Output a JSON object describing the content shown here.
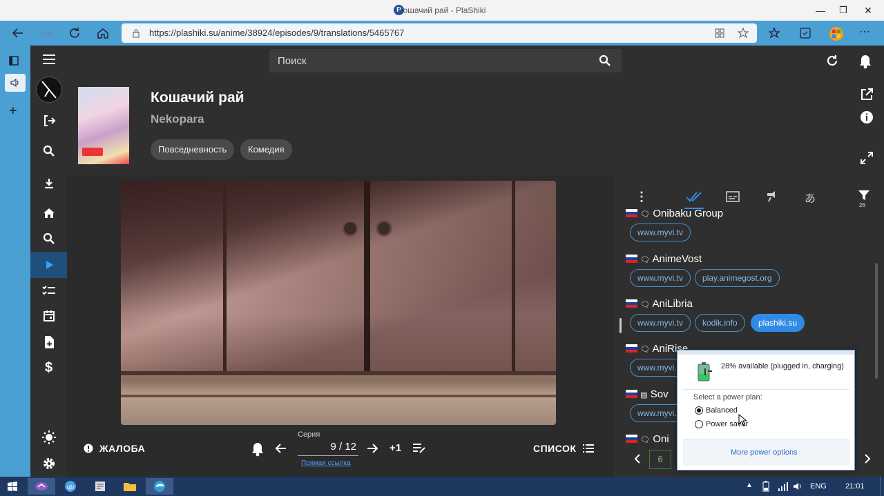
{
  "window": {
    "title": "Кошачий рай - PlaShiki",
    "minimize": "—",
    "maximize": "❐",
    "close": "✕"
  },
  "browser": {
    "url": "https://plashiki.su/anime/38924/episodes/9/translations/5465767"
  },
  "header": {
    "search_placeholder": "Поиск"
  },
  "anime": {
    "title": "Кошачий рай",
    "original_title": "Nekopara",
    "genres": [
      "Повседневность",
      "Комедия"
    ]
  },
  "player": {
    "report_label": "ЖАЛОБА",
    "episode_caption": "Серия",
    "episode_value": "9 / 12",
    "plus_one": "+1",
    "direct_link": "Прямая ссылка",
    "list_label": "СПИСОК"
  },
  "translations": {
    "filter_count": "26",
    "groups": [
      {
        "name": "Onibaku Group",
        "links": [
          "www.myvi.tv"
        ]
      },
      {
        "name": "AnimeVost",
        "links": [
          "www.myvi.tv",
          "play.animegost.org"
        ]
      },
      {
        "name": "AniLibria",
        "links": [
          "www.myvi.tv",
          "kodik.info",
          "plashiki.su"
        ],
        "active": "plashiki.su"
      },
      {
        "name": "AniRise",
        "links": [
          "www.myvi.tv"
        ]
      },
      {
        "name": "Sov",
        "links": [
          "www.myvi.tv"
        ]
      },
      {
        "name": "Oni",
        "links": []
      }
    ],
    "page": "6"
  },
  "power_popup": {
    "status": "28% available (plugged in, charging)",
    "select_label": "Select a power plan:",
    "plans": [
      "Balanced",
      "Power saver"
    ],
    "selected": "Balanced",
    "more_link": "More power options"
  },
  "taskbar": {
    "language": "ENG",
    "time": "21:01"
  },
  "colors": {
    "accent": "#2f8ae6",
    "browser_bar": "#4a9fd3",
    "active_nav": "#1f4f7a"
  }
}
